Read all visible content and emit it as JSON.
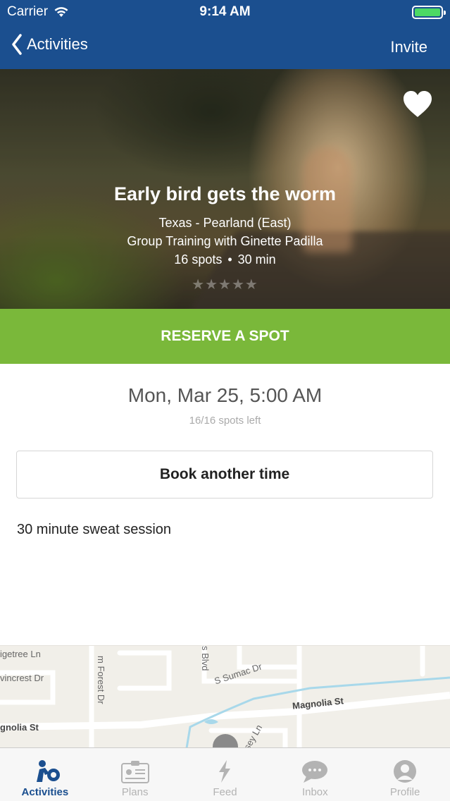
{
  "status_bar": {
    "carrier": "Carrier",
    "time": "9:14 AM"
  },
  "nav": {
    "back_label": "Activities",
    "right_label": "Invite"
  },
  "hero": {
    "title": "Early bird gets the worm",
    "location": "Texas - Pearland (East)",
    "trainer": "Group Training with Ginette Padilla",
    "spots": "16 spots",
    "duration": "30 min",
    "stars": "★★★★★",
    "rating": 0
  },
  "reserve_label": "RESERVE A SPOT",
  "session": {
    "date": "Mon, Mar 25, 5:00 AM",
    "spots_left": "16/16 spots left"
  },
  "book_another_label": "Book another time",
  "description": "30 minute sweat session",
  "map": {
    "labels": [
      "igetree Ln",
      "vincrest Dr",
      "m Forest Dr",
      "s Blvd",
      "S Sumac Dr",
      "Magnolia St",
      "gnolia St",
      "sey Ln"
    ]
  },
  "tabs": [
    {
      "label": "Activities",
      "icon": "activities-icon",
      "active": true
    },
    {
      "label": "Plans",
      "icon": "plans-icon",
      "active": false
    },
    {
      "label": "Feed",
      "icon": "feed-icon",
      "active": false
    },
    {
      "label": "Inbox",
      "icon": "inbox-icon",
      "active": false
    },
    {
      "label": "Profile",
      "icon": "profile-icon",
      "active": false
    }
  ],
  "colors": {
    "nav": "#1b4f8f",
    "reserve": "#7ab83a",
    "tab_active": "#1b4f8f",
    "tab_inactive": "#b3b3b3"
  }
}
